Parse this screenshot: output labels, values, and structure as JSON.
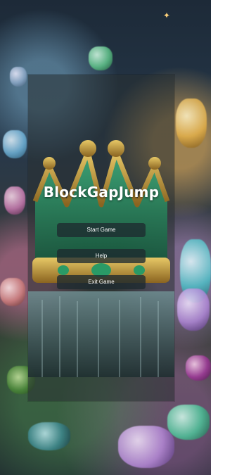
{
  "game": {
    "title": "BlockGapJump"
  },
  "menu": {
    "start_label": "Start Game",
    "help_label": "Help",
    "exit_label": "Exit Game"
  },
  "colors": {
    "overlay": "#283032",
    "button": "#1e2a30",
    "text": "#ffffff",
    "crown_gold": "#c9a23a",
    "crown_emerald": "#1f7a52"
  }
}
